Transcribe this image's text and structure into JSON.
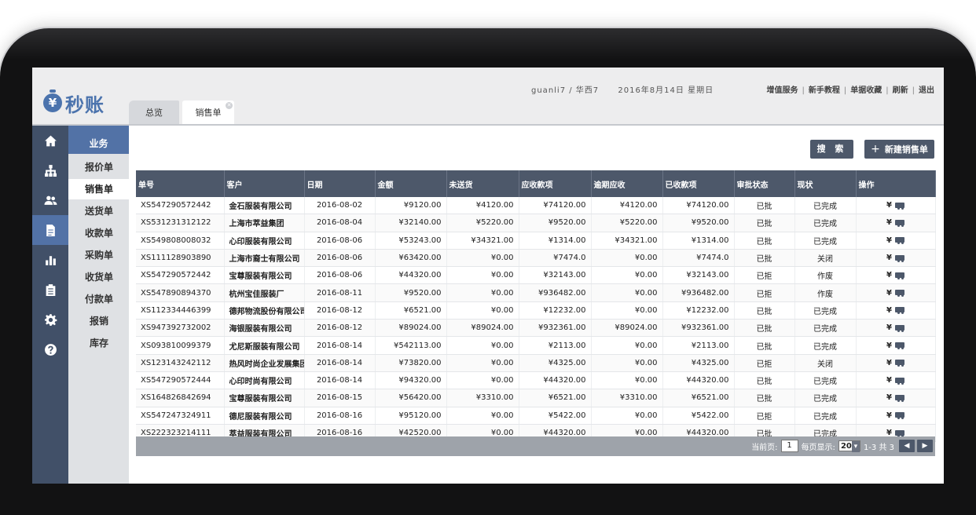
{
  "header": {
    "logo_mark": "¥",
    "logo_text": "秒账",
    "user": "guanli7 / 华西7",
    "date": "2016年8月14日 星期日",
    "links": [
      "增值服务",
      "新手教程",
      "单据收藏",
      "刷新",
      "退出"
    ]
  },
  "tabs": [
    {
      "label": "总览"
    },
    {
      "label": "销售单"
    }
  ],
  "sidebar_icons": [
    "home-icon",
    "org-icon",
    "users-icon",
    "document-icon",
    "chart-icon",
    "clipboard-icon",
    "settings-icon",
    "help-icon"
  ],
  "submenu": {
    "title": "业务",
    "items": [
      "报价单",
      "销售单",
      "送货单",
      "收款单",
      "采购单",
      "收货单",
      "付款单",
      "报销",
      "库存"
    ],
    "active": "销售单"
  },
  "toolbar": {
    "search_label": "搜 索",
    "new_icon": "+",
    "new_label": "新建销售单"
  },
  "table": {
    "columns": [
      "单号",
      "客户",
      "日期",
      "金额",
      "未送货",
      "应收款项",
      "逾期应收",
      "已收款项",
      "审批状态",
      "现状",
      "操作"
    ],
    "rows": [
      [
        "XS547290572442",
        "金石服装有限公司",
        "2016-08-02",
        "¥9120.00",
        "¥4120.00",
        "¥74120.00",
        "¥4120.00",
        "¥74120.00",
        "已批",
        "已完成"
      ],
      [
        "XS531231312122",
        "上海市萃益集团",
        "2016-08-04",
        "¥32140.00",
        "¥5220.00",
        "¥9520.00",
        "¥5220.00",
        "¥9520.00",
        "已批",
        "已完成"
      ],
      [
        "XS549808008032",
        "心印服装有限公司",
        "2016-08-06",
        "¥53243.00",
        "¥34321.00",
        "¥1314.00",
        "¥34321.00",
        "¥1314.00",
        "已批",
        "已完成"
      ],
      [
        "XS111128903890",
        "上海市裔士有限公司",
        "2016-08-06",
        "¥63420.00",
        "¥0.00",
        "¥7474.0",
        "¥0.00",
        "¥7474.0",
        "已批",
        "关闭"
      ],
      [
        "XS547290572442",
        "宝尊服装有限公司",
        "2016-08-06",
        "¥44320.00",
        "¥0.00",
        "¥32143.00",
        "¥0.00",
        "¥32143.00",
        "已拒",
        "作废"
      ],
      [
        "XS547890894370",
        "杭州宝佳服装厂",
        "2016-08-11",
        "¥9520.00",
        "¥0.00",
        "¥936482.00",
        "¥0.00",
        "¥936482.00",
        "已拒",
        "作废"
      ],
      [
        "XS112334446399",
        "德邦物流股份有限公司",
        "2016-08-12",
        "¥6521.00",
        "¥0.00",
        "¥12232.00",
        "¥0.00",
        "¥12232.00",
        "已批",
        "已完成"
      ],
      [
        "XS947392732002",
        "海银服装有限公司",
        "2016-08-12",
        "¥89024.00",
        "¥89024.00",
        "¥932361.00",
        "¥89024.00",
        "¥932361.00",
        "已批",
        "已完成"
      ],
      [
        "XS093810099379",
        "尤尼斯服装有限公司",
        "2016-08-14",
        "¥542113.00",
        "¥0.00",
        "¥2113.00",
        "¥0.00",
        "¥2113.00",
        "已批",
        "已完成"
      ],
      [
        "XS123143242112",
        "热风时尚企业发展集团",
        "2016-08-14",
        "¥73820.00",
        "¥0.00",
        "¥4325.00",
        "¥0.00",
        "¥4325.00",
        "已拒",
        "关闭"
      ],
      [
        "XS547290572444",
        "心印时尚有限公司",
        "2016-08-14",
        "¥94320.00",
        "¥0.00",
        "¥44320.00",
        "¥0.00",
        "¥44320.00",
        "已批",
        "已完成"
      ],
      [
        "XS164826842694",
        "宝尊服装有限公司",
        "2016-08-15",
        "¥56420.00",
        "¥3310.00",
        "¥6521.00",
        "¥3310.00",
        "¥6521.00",
        "已批",
        "已完成"
      ],
      [
        "XS547247324911",
        "德尼服装有限公司",
        "2016-08-16",
        "¥95120.00",
        "¥0.00",
        "¥5422.00",
        "¥0.00",
        "¥5422.00",
        "已拒",
        "已完成"
      ],
      [
        "XS222323214111",
        "萃益服装有限公司",
        "2016-08-16",
        "¥42520.00",
        "¥0.00",
        "¥44320.00",
        "¥0.00",
        "¥44320.00",
        "已批",
        "已完成"
      ]
    ],
    "op_yen": "¥"
  },
  "pager": {
    "current_label": "当前页:",
    "current": "1",
    "per_page_label": "每页显示:",
    "per_page": "20",
    "range": "1-3 共 3",
    "prev": "◀",
    "next": "▶"
  }
}
